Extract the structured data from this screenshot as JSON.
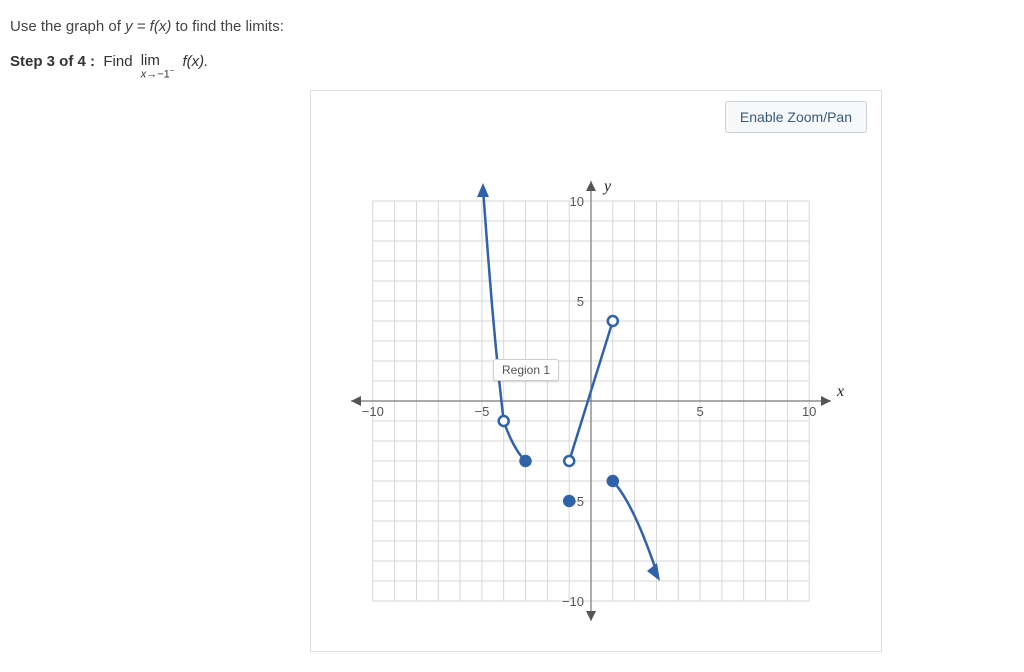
{
  "prompt_prefix": "Use the graph of ",
  "prompt_eq": "y = f(x)",
  "prompt_suffix": " to find the limits:",
  "step_label": "Step 3 of 4 :",
  "step_find": "Find",
  "lim_word": "lim",
  "lim_sub": "x→−1⁻",
  "step_fx": "f(x).",
  "zoom_label": "Enable Zoom/Pan",
  "tooltip_region": "Region 1",
  "axis_y": "y",
  "axis_x": "x",
  "ticks": {
    "xneg10": "−10",
    "xneg5": "−5",
    "xpos5": "5",
    "xpos10": "10",
    "ypos10": "10",
    "ypos5": "5",
    "yneg5": "−5",
    "yneg10": "−10"
  },
  "chart_data": {
    "type": "line",
    "xlim": [
      -10,
      10
    ],
    "ylim": [
      -10,
      10
    ],
    "xlabel": "x",
    "ylabel": "y",
    "grid": true,
    "series": [
      {
        "name": "piece1",
        "kind": "curve_with_arrow_up",
        "approx_points": [
          [
            -5,
            10
          ],
          [
            -4.5,
            4
          ],
          [
            -4,
            -1
          ]
        ],
        "open_at": [
          -4,
          -1
        ]
      },
      {
        "name": "piece2",
        "kind": "segment",
        "approx_points": [
          [
            -4,
            -1
          ],
          [
            -3,
            -3
          ]
        ],
        "open_at": [
          -4,
          -1
        ],
        "closed_at": [
          -3,
          -3
        ]
      },
      {
        "name": "piece3",
        "kind": "segment",
        "approx_points": [
          [
            -1,
            -3
          ],
          [
            1,
            4
          ]
        ],
        "open_at_both": [
          [
            -1,
            -3
          ],
          [
            1,
            4
          ]
        ]
      },
      {
        "name": "piece4",
        "kind": "curve_with_arrow_down",
        "approx_points": [
          [
            1,
            -4
          ],
          [
            2,
            -5
          ],
          [
            3,
            -8
          ]
        ],
        "closed_at": [
          1,
          -4
        ]
      }
    ],
    "isolated_points": [
      {
        "xy": [
          -1,
          -5
        ],
        "style": "closed"
      }
    ],
    "annotations": [
      {
        "text": "Region 1",
        "near_xy": [
          -3,
          0.5
        ]
      }
    ]
  }
}
